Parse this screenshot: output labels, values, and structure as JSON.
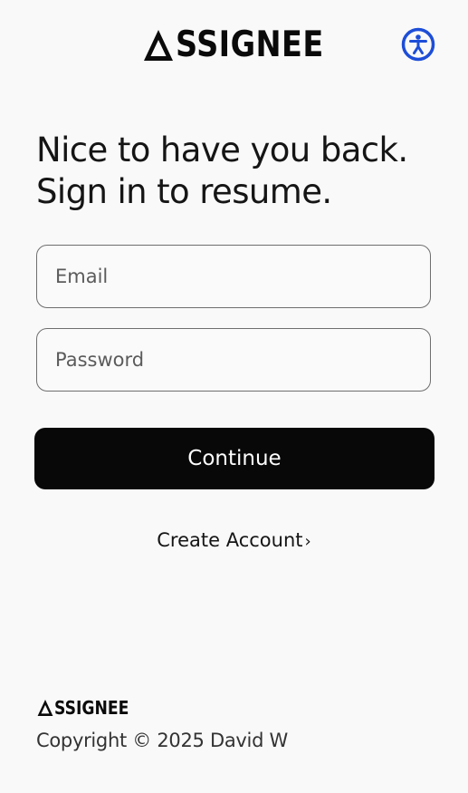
{
  "header": {
    "logo_text": "SSIGNEE",
    "accessibility_icon": "accessibility-icon",
    "accent_color": "#1d4ed8"
  },
  "headline": {
    "line1": "Nice to have you back.",
    "line2": "Sign in to resume."
  },
  "form": {
    "email_placeholder": "Email",
    "email_value": "",
    "password_placeholder": "Password",
    "password_value": "",
    "continue_label": "Continue",
    "continue_color": "#080808"
  },
  "links": {
    "create_account": "Create Account",
    "create_account_chevron": "›"
  },
  "footer": {
    "logo_text": "SSIGNEE",
    "copyright": "Copyright © 2025 David W"
  }
}
